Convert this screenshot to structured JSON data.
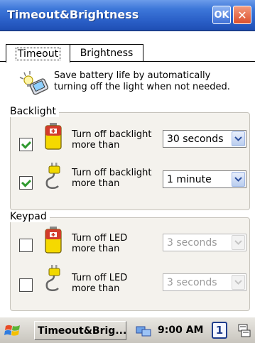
{
  "window": {
    "title": "Timeout&Brightness",
    "ok_label": "OK",
    "close_label": "✕"
  },
  "tabs": [
    {
      "label": "Timeout",
      "active": true
    },
    {
      "label": "Brightness",
      "active": false
    }
  ],
  "intro": {
    "line1": "Save battery life by automatically",
    "line2": "turning off the light when not needed.",
    "icon": "lightbulb-device-icon"
  },
  "backlight": {
    "label": "Backlight",
    "rows": [
      {
        "line1": "Turn off backlight",
        "line2": "more than",
        "value": "30 seconds",
        "checked": true,
        "icon": "battery-icon"
      },
      {
        "line1": "Turn off backlight",
        "line2": "more than",
        "value": "1 minute",
        "checked": true,
        "icon": "power-plug-icon"
      }
    ]
  },
  "keypad": {
    "label": "Keypad",
    "rows": [
      {
        "line1": "Turn off LED",
        "line2": "more than",
        "value": "3 seconds",
        "checked": false,
        "icon": "battery-icon"
      },
      {
        "line1": "Turn off LED",
        "line2": "more than",
        "value": "3 seconds",
        "checked": false,
        "icon": "power-plug-icon"
      }
    ]
  },
  "taskbar": {
    "task_label": "Timeout&Brig...",
    "time": "9:00 AM",
    "desktop_number": "1"
  },
  "colors": {
    "titlebar": "#2a5fc7",
    "ok_button": "#3d6fd6",
    "close_button": "#dc4f2c",
    "checkmark": "#2f9a2f"
  }
}
